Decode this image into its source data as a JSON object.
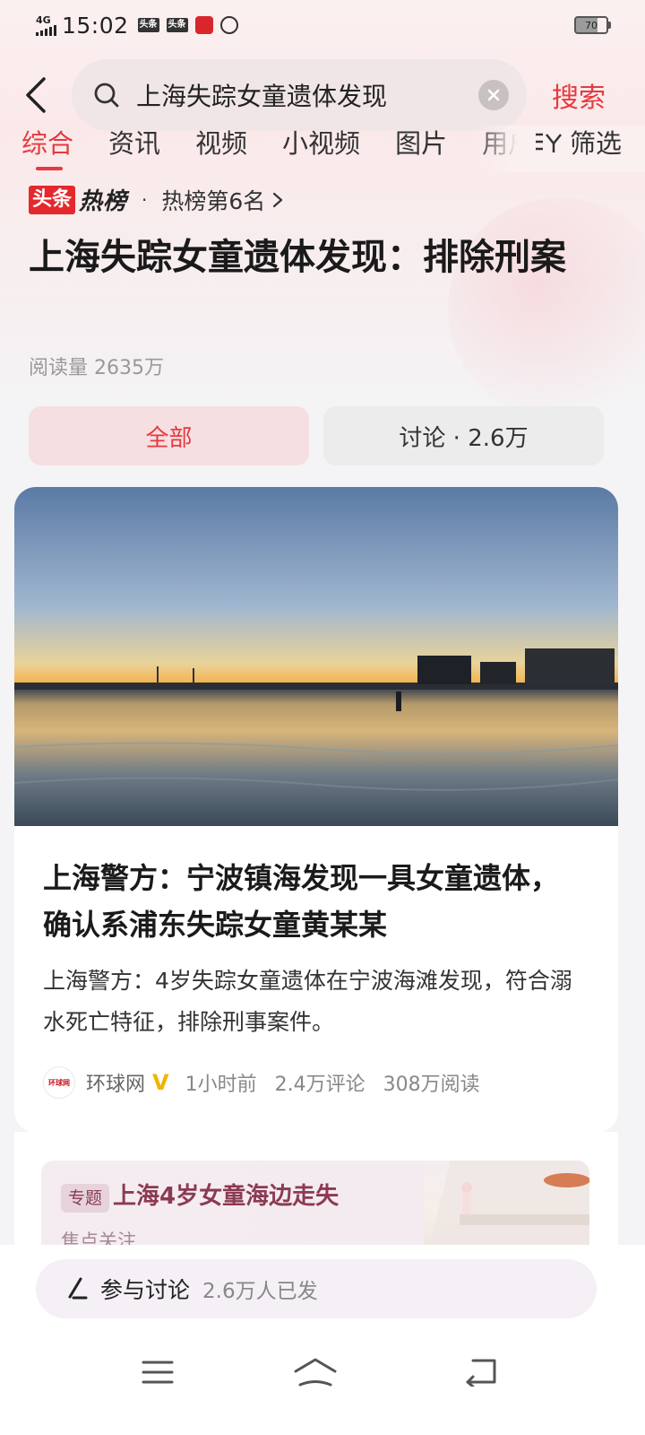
{
  "status_bar": {
    "network": "4G",
    "time": "15:02",
    "app_icons": [
      "头条",
      "头条"
    ],
    "battery": "70"
  },
  "search": {
    "query": "上海失踪女童遗体发现",
    "submit_label": "搜索"
  },
  "tabs": [
    "综合",
    "资讯",
    "视频",
    "小视频",
    "图片",
    "用户"
  ],
  "filter_label": "筛选",
  "hot": {
    "logo_left": "头条",
    "logo_right": "热榜",
    "separator": "·",
    "rank_text": "热榜第6名",
    "headline": "上海失踪女童遗体发现：排除刑案",
    "read_count": "阅读量 2635万"
  },
  "chips": {
    "all": "全部",
    "discuss": "讨论 · 2.6万"
  },
  "article": {
    "title": "上海警方：宁波镇海发现一具女童遗体，确认系浦东失踪女童黄某某",
    "summary": "上海警方：4岁失踪女童遗体在宁波海滩发现，符合溺水死亡特征，排除刑事案件。",
    "source_logo_text": "环球网",
    "source": "环球网",
    "verified_badge": "V",
    "time_ago": "1小时前",
    "comments": "2.4万评论",
    "reads": "308万阅读"
  },
  "topic": {
    "tag": "专题",
    "title": "上海4岁女童海边走失",
    "subtitle": "焦点关注"
  },
  "comment_bar": {
    "label": "参与讨论",
    "count": "2.6万人已发"
  },
  "colors": {
    "accent": "#e53a3f",
    "chip_active_bg": "#f6dfe0",
    "topic_text": "#8c3a52"
  }
}
